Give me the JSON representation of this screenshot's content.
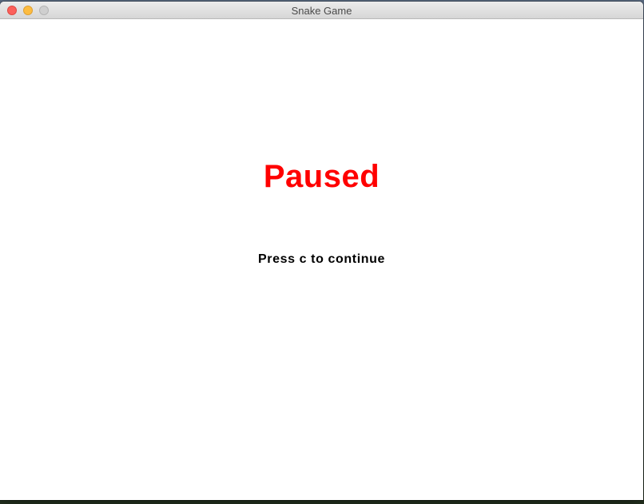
{
  "window": {
    "title": "Snake Game"
  },
  "game": {
    "status_text": "Paused",
    "status_color": "#ff0000",
    "hint_text": "Press c to continue",
    "hint_color": "#000000",
    "background_color": "#ffffff"
  }
}
